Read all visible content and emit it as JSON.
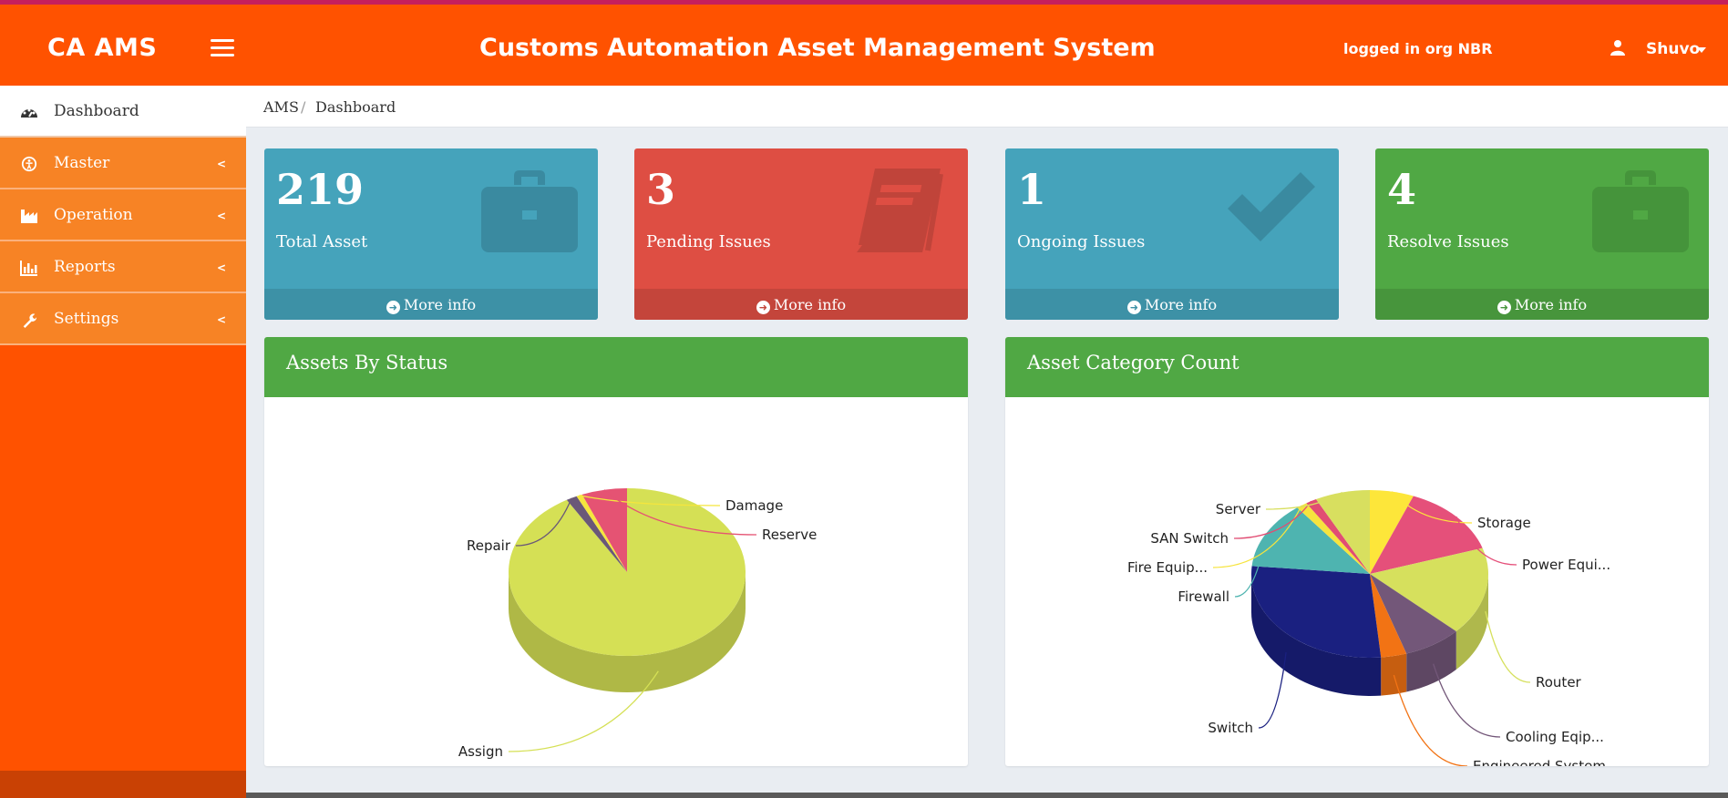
{
  "header": {
    "brand": "CA AMS",
    "title": "Customs Automation Asset Management System",
    "login_status": "logged in org NBR",
    "user_name": "Shuvo"
  },
  "sidebar": {
    "items": [
      {
        "label": "Dashboard",
        "icon": "tachometer-icon",
        "active": true
      },
      {
        "label": "Master",
        "icon": "accessibility-icon",
        "chevron": "<"
      },
      {
        "label": "Operation",
        "icon": "industry-icon",
        "chevron": "<"
      },
      {
        "label": "Reports",
        "icon": "bar-chart-icon",
        "chevron": "<"
      },
      {
        "label": "Settings",
        "icon": "wrench-icon",
        "chevron": "<"
      }
    ]
  },
  "breadcrumb": {
    "root": "AMS",
    "separator": "/",
    "current": "Dashboard"
  },
  "cards": [
    {
      "value": "219",
      "label": "Total Asset",
      "more": "More info",
      "icon": "briefcase-icon",
      "color": "#45a3bb"
    },
    {
      "value": "3",
      "label": "Pending Issues",
      "more": "More info",
      "icon": "book-icon",
      "color": "#de4e43"
    },
    {
      "value": "1",
      "label": "Ongoing Issues",
      "more": "More info",
      "icon": "check-icon",
      "color": "#45a3bb"
    },
    {
      "value": "4",
      "label": "Resolve Issues",
      "more": "More info",
      "icon": "briefcase-icon",
      "color": "#50a844"
    }
  ],
  "panels": {
    "status_title": "Assets By Status",
    "category_title": "Asset Category Count"
  },
  "chart_data": [
    {
      "type": "pie",
      "title": "Assets By Status",
      "categories": [
        "Assign",
        "Repair",
        "Damage",
        "Reserve"
      ],
      "values": [
        91.5,
        1.5,
        0.8,
        6.2
      ],
      "colors": [
        "#d5e055",
        "#6a5878",
        "#f5e63d",
        "#e55373"
      ]
    },
    {
      "type": "pie",
      "title": "Asset Category Count",
      "categories": [
        "Storage",
        "Power Equi...",
        "Router",
        "Cooling Eqip...",
        "Engineered System",
        "Switch",
        "Firewall",
        "Fire Equip...",
        "SAN Switch",
        "Server"
      ],
      "values": [
        6,
        14,
        17,
        8,
        3.5,
        28,
        13,
        1.5,
        1.5,
        7.5
      ],
      "colors": [
        "#fde63a",
        "#e5507a",
        "#d6e05d",
        "#735779",
        "#f27314",
        "#1a2080",
        "#4eb4b0",
        "#f6e43e",
        "#e14d73",
        "#d8df5f"
      ]
    }
  ]
}
